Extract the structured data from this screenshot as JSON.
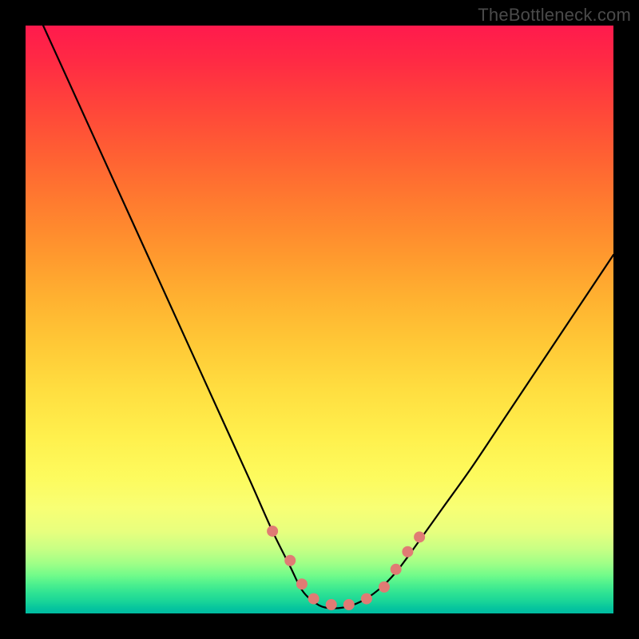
{
  "watermark": "TheBottleneck.com",
  "chart_data": {
    "type": "line",
    "title": "",
    "xlabel": "",
    "ylabel": "",
    "xlim": [
      0,
      100
    ],
    "ylim": [
      0,
      100
    ],
    "grid": false,
    "legend": false,
    "background_gradient": {
      "top": "#ff1a4d",
      "mid": "#ffe045",
      "bottom": "#00bca1"
    },
    "series": [
      {
        "name": "bottleneck-curve",
        "color": "#000000",
        "x": [
          3,
          8,
          13,
          18,
          23,
          28,
          33,
          38,
          42,
          45,
          47,
          49,
          51,
          54,
          57,
          60,
          63,
          66,
          71,
          76,
          82,
          88,
          94,
          100
        ],
        "y": [
          100,
          89,
          78,
          67,
          56,
          45,
          34,
          23,
          14,
          8,
          4,
          2,
          1,
          1,
          2,
          4,
          7,
          11,
          18,
          25,
          34,
          43,
          52,
          61
        ]
      }
    ],
    "markers": {
      "name": "highlight-dots",
      "color": "#e07b74",
      "radius": 7,
      "points": [
        {
          "x": 42,
          "y": 14
        },
        {
          "x": 45,
          "y": 9
        },
        {
          "x": 47,
          "y": 5
        },
        {
          "x": 49,
          "y": 2.5
        },
        {
          "x": 52,
          "y": 1.5
        },
        {
          "x": 55,
          "y": 1.5
        },
        {
          "x": 58,
          "y": 2.5
        },
        {
          "x": 61,
          "y": 4.5
        },
        {
          "x": 63,
          "y": 7.5
        },
        {
          "x": 65,
          "y": 10.5
        },
        {
          "x": 67,
          "y": 13
        }
      ]
    }
  }
}
